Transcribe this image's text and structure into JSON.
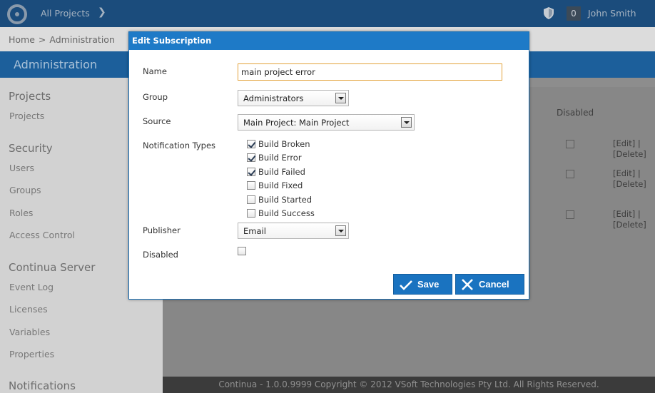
{
  "topbar": {
    "project_switch_label": "All Projects",
    "notification_count": "0",
    "user_name": "John Smith"
  },
  "breadcrumb": {
    "home": "Home",
    "separator": ">",
    "current": "Administration"
  },
  "admin": {
    "title": "Administration"
  },
  "sidebar": {
    "sections": [
      {
        "heading": "Projects",
        "items": [
          "Projects"
        ]
      },
      {
        "heading": "Security",
        "items": [
          "Users",
          "Groups",
          "Roles",
          "Access Control"
        ]
      },
      {
        "heading": "Continua Server",
        "items": [
          "Event Log",
          "Licenses",
          "Variables",
          "Properties"
        ]
      },
      {
        "heading": "Notifications",
        "items": []
      }
    ]
  },
  "content": {
    "disabled_column_header": "Disabled",
    "row_links": [
      {
        "edit": "[Edit] |",
        "delete": "[Delete]"
      },
      {
        "edit": "[Edit] |",
        "delete": "[Delete]"
      },
      {
        "edit": "[Edit] |",
        "delete": "[Delete]"
      }
    ]
  },
  "footer": {
    "text": "Continua - 1.0.0.9999 Copyright © 2012 VSoft Technologies Pty Ltd. All Rights Reserved."
  },
  "modal": {
    "title": "Edit Subscription",
    "name_label": "Name",
    "name_value": "main project error",
    "group_label": "Group",
    "group_value": "Administrators",
    "source_label": "Source",
    "source_value": "Main Project: Main Project",
    "notification_types_label": "Notification Types",
    "notification_types": [
      {
        "label": "Build Broken",
        "checked": true
      },
      {
        "label": "Build Error",
        "checked": true
      },
      {
        "label": "Build Failed",
        "checked": true
      },
      {
        "label": "Build Fixed",
        "checked": false
      },
      {
        "label": "Build Started",
        "checked": false
      },
      {
        "label": "Build Success",
        "checked": false
      }
    ],
    "publisher_label": "Publisher",
    "publisher_value": "Email",
    "disabled_label": "Disabled",
    "disabled_checked": false,
    "save_label": "Save",
    "cancel_label": "Cancel"
  }
}
